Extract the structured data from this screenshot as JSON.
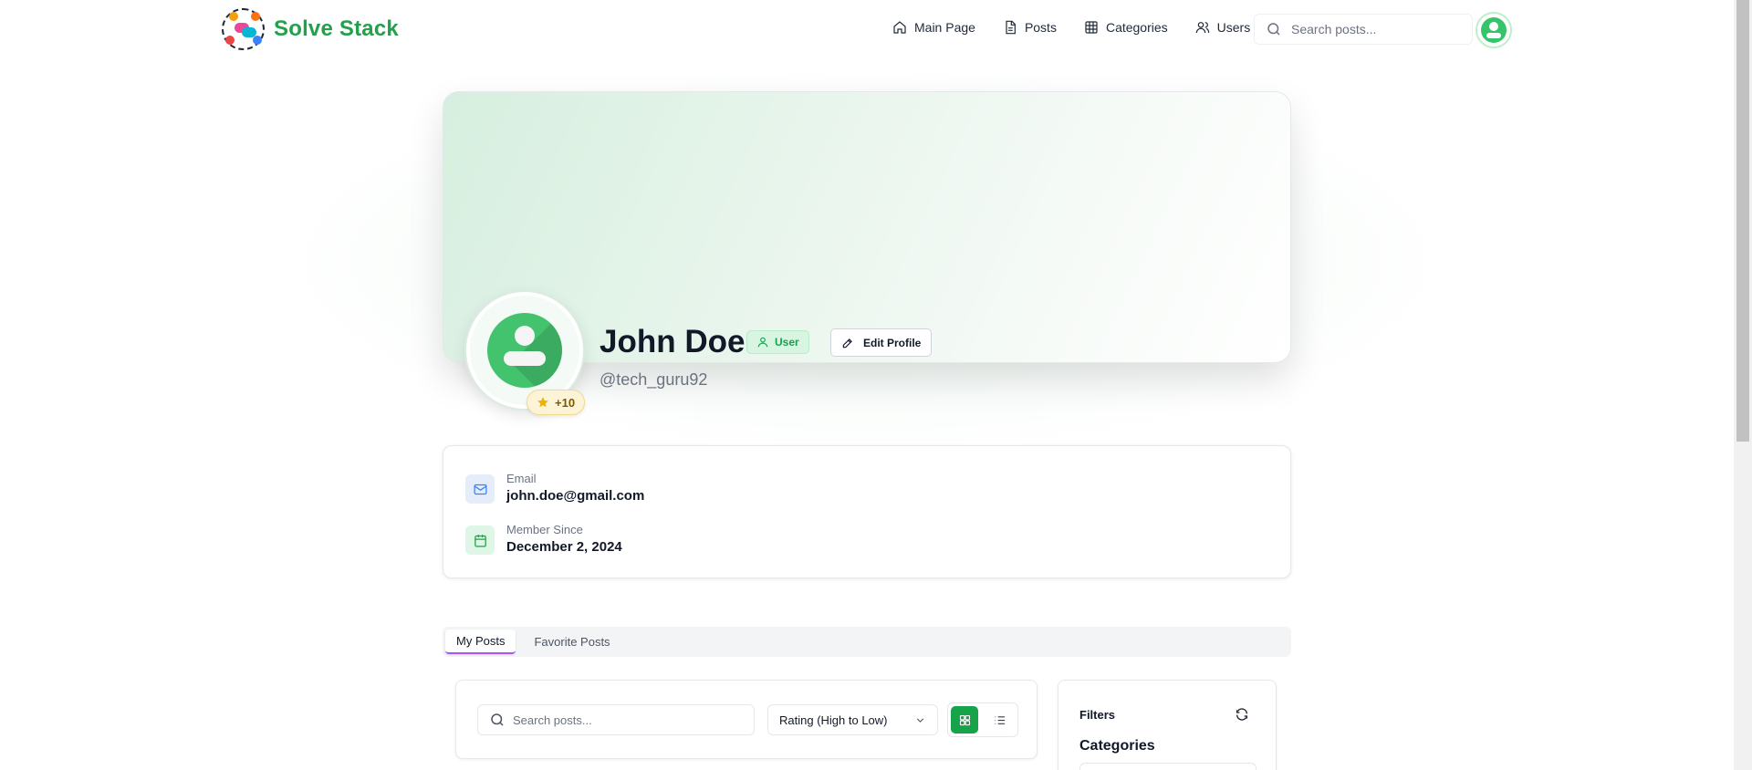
{
  "nav": {
    "brand": "Solve Stack",
    "links": [
      {
        "label": "Main Page",
        "icon": "home-icon"
      },
      {
        "label": "Posts",
        "icon": "file-icon"
      },
      {
        "label": "Categories",
        "icon": "grid-icon"
      },
      {
        "label": "Users",
        "icon": "users-icon"
      }
    ],
    "search_placeholder": "Search posts..."
  },
  "profile": {
    "name": "John Doe",
    "role": "User",
    "edit_label": "Edit Profile",
    "username": "@tech_guru92",
    "points": "+10"
  },
  "info": {
    "email_label": "Email",
    "email_value": "john.doe@gmail.com",
    "member_label": "Member Since",
    "member_value": "December 2, 2024"
  },
  "tabs": [
    {
      "label": "My Posts",
      "active": true
    },
    {
      "label": "Favorite Posts",
      "active": false
    }
  ],
  "posts_toolbar": {
    "search_placeholder": "Search posts...",
    "sort_value": "Rating (High to Low)",
    "view_mode": "grid"
  },
  "filters": {
    "title": "Filters",
    "categories_heading": "Categories"
  },
  "colors": {
    "brand_green": "#22a04b",
    "accent_green": "#16a34a",
    "tab_underline": "#a855f7",
    "points_gold": "#eab308"
  }
}
